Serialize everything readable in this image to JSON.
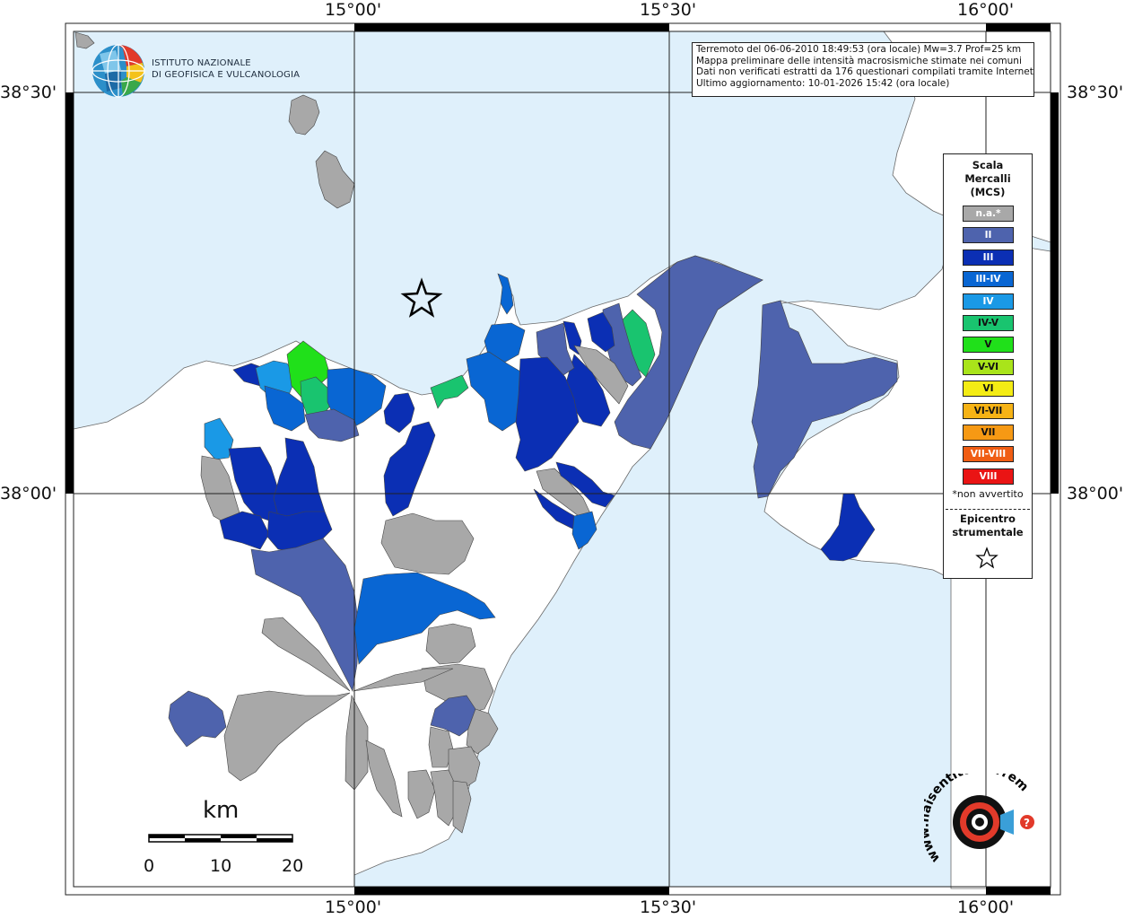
{
  "map": {
    "coordinates": {
      "top": [
        "15°00'",
        "15°30'",
        "16°00'"
      ],
      "bottom": [
        "15°00'",
        "15°30'",
        "16°00'"
      ],
      "left": [
        "38°30'",
        "38°00'"
      ],
      "right": [
        "38°30'",
        "38°00'"
      ]
    },
    "info_box": {
      "line1": "Terremoto del 06-06-2010 18:49:53 (ora locale) Mw=3.7 Prof=25 km",
      "line2": "Mappa preliminare delle intensità macrosismiche stimate nei comuni",
      "line3": "Dati non verificati estratti da 176 questionari compilati tramite Internet.",
      "line4": "Ultimo aggiornamento: 10-01-2026 15:42 (ora locale)"
    },
    "legend": {
      "title_line1": "Scala",
      "title_line2": "Mercalli",
      "title_line3": "(MCS)",
      "items": [
        {
          "label": "n.a.*",
          "color": "#a8a8a8"
        },
        {
          "label": "II",
          "color": "#4e63ad"
        },
        {
          "label": "III",
          "color": "#0b2fb4"
        },
        {
          "label": "III-IV",
          "color": "#0966d3"
        },
        {
          "label": "IV",
          "color": "#1a99e6"
        },
        {
          "label": "IV-V",
          "color": "#19c46f"
        },
        {
          "label": "V",
          "color": "#20e01a"
        },
        {
          "label": "V-VI",
          "color": "#a9e41a"
        },
        {
          "label": "VI",
          "color": "#f4ec14"
        },
        {
          "label": "VI-VII",
          "color": "#f6b315"
        },
        {
          "label": "VII",
          "color": "#f69914"
        },
        {
          "label": "VII-VIII",
          "color": "#f05d13"
        },
        {
          "label": "VIII",
          "color": "#ea1414"
        }
      ],
      "note": "*non avvertito",
      "epicenter_line1": "Epicentro",
      "epicenter_line2": "strumentale",
      "epicenter_icon": "star-outline-icon"
    },
    "logo": {
      "line1": "ISTITUTO NAZIONALE",
      "line2": "DI GEOFISICA E VULCANOLOGIA"
    },
    "scale_bar": {
      "unit": "km",
      "ticks": [
        "0",
        "10",
        "20"
      ]
    },
    "watermark": "www.haisentitoilterremoto.it",
    "colors": {
      "sea": "#dff0fb",
      "land": "#ffffff",
      "not_available": "#a8a8a8",
      "II": "#4e63ad",
      "III": "#0b2fb4",
      "III-IV": "#0966d3",
      "IV": "#1a99e6",
      "IV-V": "#19c46f",
      "V": "#20e01a"
    }
  }
}
